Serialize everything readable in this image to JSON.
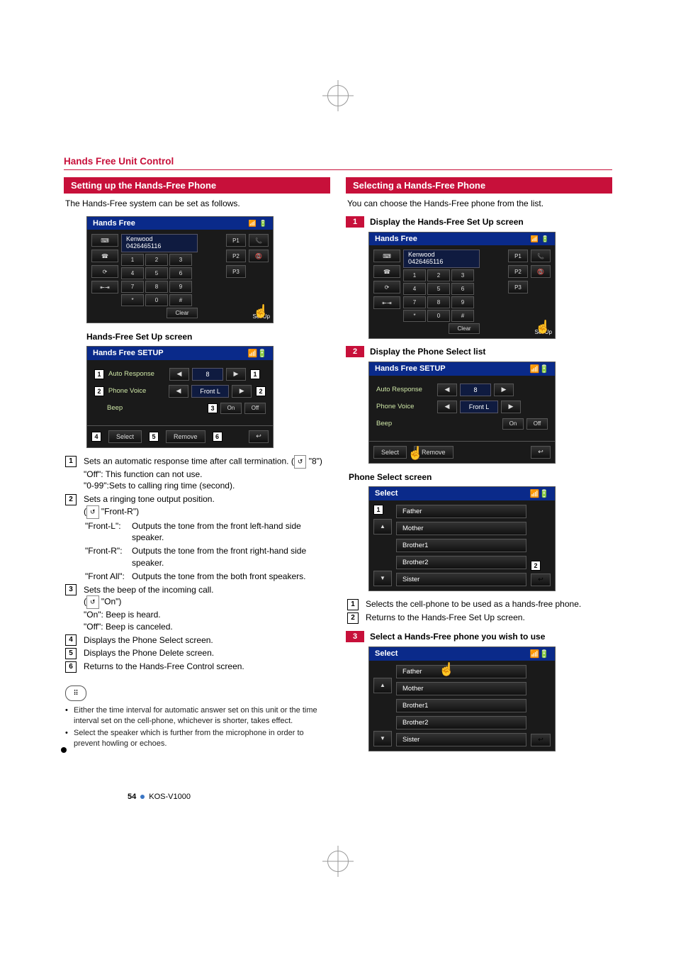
{
  "header": {
    "title": "Hands Free Unit Control"
  },
  "footer": {
    "page": "54",
    "model": "KOS-V1000"
  },
  "left": {
    "band": "Setting up the Hands-Free Phone",
    "intro": "The Hands-Free system can be set as follows.",
    "shot1": {
      "title": "Hands Free",
      "contact_name": "Kenwood",
      "contact_number": "0426465116",
      "left_buttons": [
        "⌨",
        "☎",
        "⟳",
        "⇤⇥"
      ],
      "keypad": [
        "1",
        "2",
        "3",
        "4",
        "5",
        "6",
        "7",
        "8",
        "9",
        "*",
        "0",
        "#"
      ],
      "right": [
        "P1",
        "P2",
        "P3"
      ],
      "clear": "Clear",
      "corner": "Set Up"
    },
    "setup_subhead": "Hands-Free Set Up screen",
    "setup_shot": {
      "title": "Hands Free SETUP",
      "rows": [
        {
          "label": "Auto Response",
          "value": "8"
        },
        {
          "label": "Phone Voice",
          "value": "Front L"
        },
        {
          "label": "Beep",
          "on": "On",
          "off": "Off"
        }
      ],
      "select_btn": "Select",
      "remove_btn": "Remove",
      "callouts": [
        "1",
        "2",
        "3",
        "4",
        "5",
        "6"
      ]
    },
    "desc": [
      {
        "num": "1",
        "text": "Sets an automatic response time after call termination.",
        "default": "\"8\"",
        "sub": [
          {
            "k": "\"Off\":",
            "v": "This function can not use."
          },
          {
            "k": "\"0-99\":",
            "v": "Sets to calling ring time (second)."
          }
        ]
      },
      {
        "num": "2",
        "text": "Sets a ringing tone output position.",
        "default": "\"Front-R\"",
        "pairs": [
          {
            "k": "\"Front-L\":",
            "v": "Outputs the tone from the front left-hand side speaker."
          },
          {
            "k": "\"Front-R\":",
            "v": "Outputs the tone from the front right-hand side speaker."
          },
          {
            "k": "\"Front All\":",
            "v": "Outputs the tone from the both front speakers."
          }
        ]
      },
      {
        "num": "3",
        "text": "Sets the beep of the incoming call.",
        "default": "\"On\"",
        "sub": [
          {
            "k": "\"On\":",
            "v": "Beep is heard."
          },
          {
            "k": "\"Off\":",
            "v": "Beep is canceled."
          }
        ]
      },
      {
        "num": "4",
        "text": "Displays the Phone Select screen."
      },
      {
        "num": "5",
        "text": "Displays the Phone Delete screen."
      },
      {
        "num": "6",
        "text": "Returns to the Hands-Free Control screen."
      }
    ],
    "notes": [
      "Either the time interval for automatic answer set on this unit or the time interval set on the cell-phone, whichever is shorter, takes effect.",
      "Select the speaker which is further from the microphone in order to prevent howling or echoes."
    ]
  },
  "right": {
    "band": "Selecting a Hands-Free Phone",
    "intro": "You can choose the Hands-Free phone from the list.",
    "step1": {
      "num": "1",
      "text": "Display the Hands-Free Set Up screen"
    },
    "step2": {
      "num": "2",
      "text": "Display the Phone Select list"
    },
    "step3": {
      "num": "3",
      "text": "Select a Hands-Free phone you wish to use"
    },
    "step2_shot": {
      "title": "Hands Free SETUP",
      "auto": "Auto Response",
      "auto_val": "8",
      "voice": "Phone Voice",
      "voice_val": "Front L",
      "beep": "Beep",
      "on": "On",
      "off": "Off",
      "select": "Select",
      "remove": "Remove"
    },
    "phone_select_subhead": "Phone Select screen",
    "select_shot": {
      "title": "Select",
      "items": [
        "Father",
        "Mother",
        "Brother1",
        "Brother2",
        "Sister"
      ],
      "callouts": [
        "1",
        "2"
      ]
    },
    "select_desc": [
      {
        "num": "1",
        "text": "Selects the cell-phone to be used as a hands-free phone."
      },
      {
        "num": "2",
        "text": "Returns to the Hands-Free Set Up screen."
      }
    ]
  }
}
